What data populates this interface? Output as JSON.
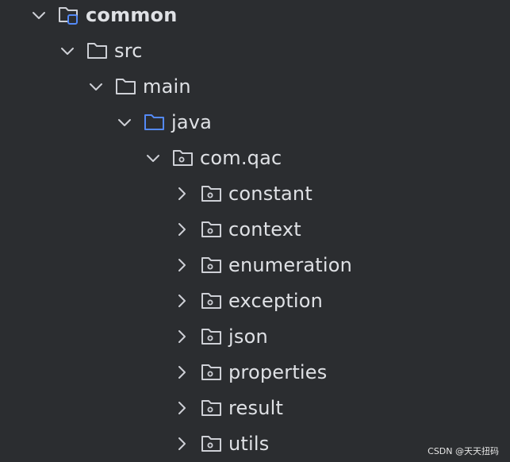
{
  "tree": {
    "root": {
      "label": "common",
      "expanded": true,
      "icon": "module-folder-icon"
    },
    "src": {
      "label": "src",
      "expanded": true,
      "icon": "folder-icon"
    },
    "main": {
      "label": "main",
      "expanded": true,
      "icon": "folder-icon"
    },
    "java": {
      "label": "java",
      "expanded": true,
      "icon": "source-root-folder-icon"
    },
    "package": {
      "label": "com.qac",
      "expanded": true,
      "icon": "package-folder-icon"
    },
    "children": [
      {
        "label": "constant",
        "expanded": false,
        "icon": "package-folder-icon"
      },
      {
        "label": "context",
        "expanded": false,
        "icon": "package-folder-icon"
      },
      {
        "label": "enumeration",
        "expanded": false,
        "icon": "package-folder-icon"
      },
      {
        "label": "exception",
        "expanded": false,
        "icon": "package-folder-icon"
      },
      {
        "label": "json",
        "expanded": false,
        "icon": "package-folder-icon"
      },
      {
        "label": "properties",
        "expanded": false,
        "icon": "package-folder-icon"
      },
      {
        "label": "result",
        "expanded": false,
        "icon": "package-folder-icon"
      },
      {
        "label": "utils",
        "expanded": false,
        "icon": "package-folder-icon"
      }
    ]
  },
  "colors": {
    "background": "#2b2d30",
    "text": "#dfe1e5",
    "icon_stroke": "#ced0d6",
    "source_root_blue": "#548af7"
  },
  "watermark": "CSDN @天天扭码"
}
